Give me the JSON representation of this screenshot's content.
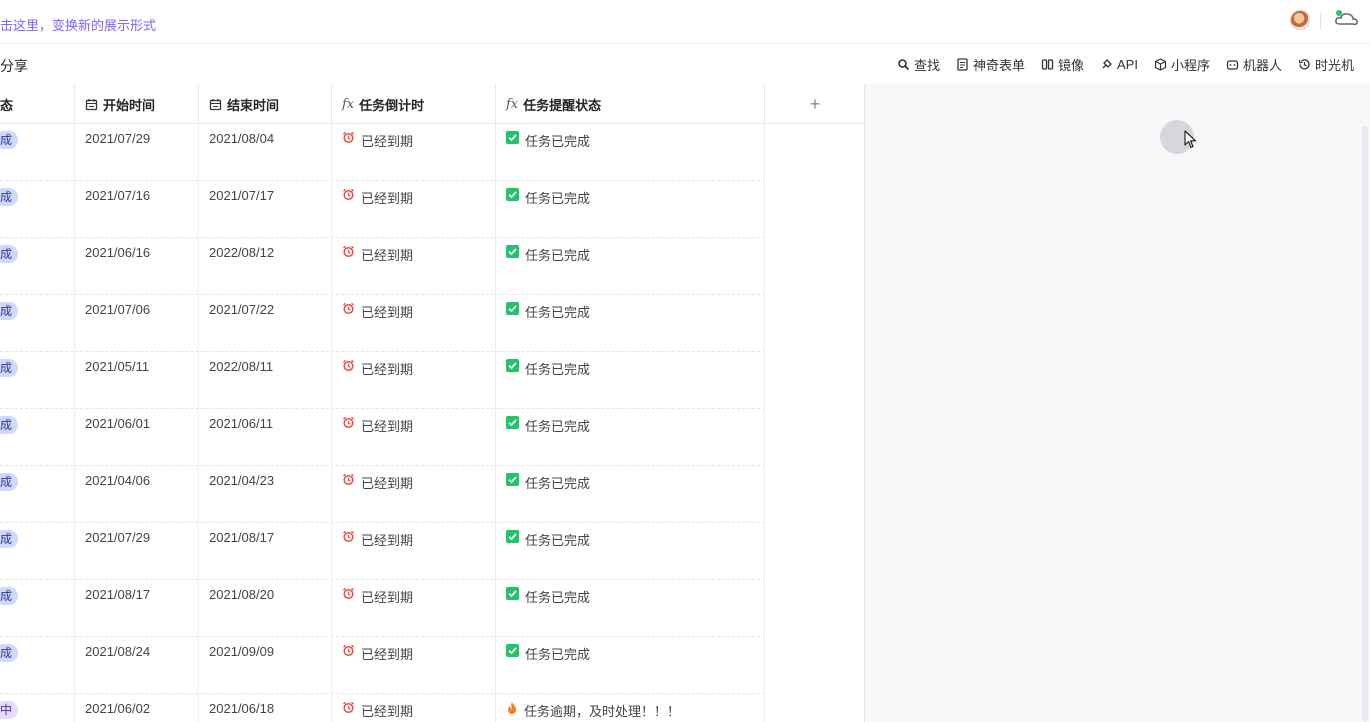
{
  "topbar": {
    "hint": "击这里，变换新的展示形式"
  },
  "toolbar": {
    "share": "分享",
    "tools": [
      {
        "label": "查找",
        "icon": "search-icon"
      },
      {
        "label": "神奇表单",
        "icon": "form-icon"
      },
      {
        "label": "镜像",
        "icon": "mirror-icon"
      },
      {
        "label": "API",
        "icon": "api-icon"
      },
      {
        "label": "小程序",
        "icon": "cube-icon"
      },
      {
        "label": "机器人",
        "icon": "robot-icon"
      },
      {
        "label": "时光机",
        "icon": "history-icon"
      }
    ]
  },
  "columns": {
    "status": "态",
    "start": "开始时间",
    "end": "结束时间",
    "countdown": "任务倒计时",
    "remind": "任务提醒状态",
    "add": "+"
  },
  "rows": [
    {
      "status": "成",
      "start": "2021/07/29",
      "end": "2021/08/04",
      "countdown": "已经到期",
      "remind": "任务已完成",
      "remind_type": "done"
    },
    {
      "status": "成",
      "start": "2021/07/16",
      "end": "2021/07/17",
      "countdown": "已经到期",
      "remind": "任务已完成",
      "remind_type": "done"
    },
    {
      "status": "成",
      "start": "2021/06/16",
      "end": "2022/08/12",
      "countdown": "已经到期",
      "remind": "任务已完成",
      "remind_type": "done"
    },
    {
      "status": "成",
      "start": "2021/07/06",
      "end": "2021/07/22",
      "countdown": "已经到期",
      "remind": "任务已完成",
      "remind_type": "done"
    },
    {
      "status": "成",
      "start": "2021/05/11",
      "end": "2022/08/11",
      "countdown": "已经到期",
      "remind": "任务已完成",
      "remind_type": "done"
    },
    {
      "status": "成",
      "start": "2021/06/01",
      "end": "2021/06/11",
      "countdown": "已经到期",
      "remind": "任务已完成",
      "remind_type": "done"
    },
    {
      "status": "成",
      "start": "2021/04/06",
      "end": "2021/04/23",
      "countdown": "已经到期",
      "remind": "任务已完成",
      "remind_type": "done"
    },
    {
      "status": "成",
      "start": "2021/07/29",
      "end": "2021/08/17",
      "countdown": "已经到期",
      "remind": "任务已完成",
      "remind_type": "done"
    },
    {
      "status": "成",
      "start": "2021/08/17",
      "end": "2021/08/20",
      "countdown": "已经到期",
      "remind": "任务已完成",
      "remind_type": "done"
    },
    {
      "status": "成",
      "start": "2021/08/24",
      "end": "2021/09/09",
      "countdown": "已经到期",
      "remind": "任务已完成",
      "remind_type": "done"
    },
    {
      "status": "中",
      "start": "2021/06/02",
      "end": "2021/06/18",
      "countdown": "已经到期",
      "remind": "任务逾期，及时处理！！！",
      "remind_type": "overdue"
    }
  ],
  "colors": {
    "accent": "#7b66ff",
    "tag_done": "#cfd8ff",
    "tag_doing": "#e6dcff",
    "check_green": "#21c36b",
    "alarm_red": "#f04a3c",
    "fire_orange": "#ff7a1a"
  }
}
